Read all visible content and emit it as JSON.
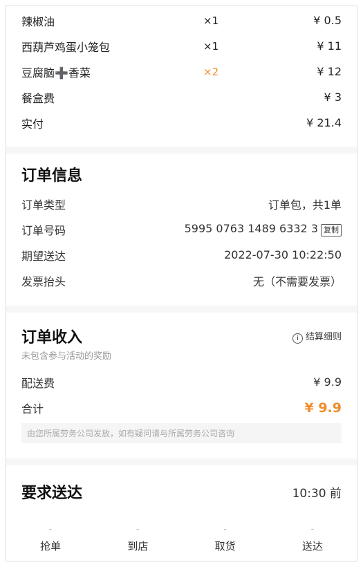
{
  "items": [
    {
      "name": "辣椒油",
      "qty": "×1",
      "price": "¥ 0.5",
      "qty_highlight": false
    },
    {
      "name": "西葫芦鸡蛋小笼包",
      "qty": "×1",
      "price": "¥ 11",
      "qty_highlight": false
    },
    {
      "name": "豆腐脑➕香菜",
      "qty": "×2",
      "price": "¥ 12",
      "qty_highlight": true
    }
  ],
  "fees": {
    "box_label": "餐盒费",
    "box_value": "¥ 3",
    "paid_label": "实付",
    "paid_value": "¥ 21.4"
  },
  "order_info": {
    "title": "订单信息",
    "rows": [
      {
        "label": "订单类型",
        "value": "订单包，共1单"
      },
      {
        "label": "订单号码",
        "value": "5995 0763 1489 6332 3"
      },
      {
        "label": "期望送达",
        "value": "2022-07-30 10:22:50"
      },
      {
        "label": "发票抬头",
        "value": "无（不需要发票）"
      }
    ],
    "copy_label": "复制"
  },
  "income": {
    "title": "订单收入",
    "detail_link": "结算细则",
    "subtitle": "未包含参与活动的奖励",
    "delivery_label": "配送费",
    "delivery_value": "¥ 9.9",
    "total_label": "合计",
    "total_value": "¥ 9.9",
    "notice": "由您所属劳务公司发放，如有疑问请与所属劳务公司咨询"
  },
  "delivery": {
    "title": "要求送达",
    "time": "10:30 前",
    "steps": [
      {
        "dash": "-",
        "label": "抢单"
      },
      {
        "dash": "-",
        "label": "到店"
      },
      {
        "dash": "-",
        "label": "取货"
      },
      {
        "dash": "-",
        "label": "送达"
      }
    ]
  },
  "colors": {
    "accent": "#f08c2b"
  }
}
